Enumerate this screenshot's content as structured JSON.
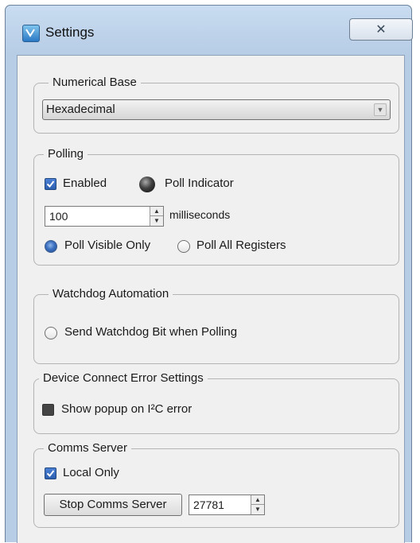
{
  "window": {
    "title": "Settings",
    "close_glyph": "✕",
    "icons": {
      "app": "app-logo-icon",
      "close": "close-icon"
    }
  },
  "numerical_base": {
    "legend": "Numerical Base",
    "selected": "Hexadecimal"
  },
  "polling": {
    "legend": "Polling",
    "enabled_label": "Enabled",
    "enabled_checked": true,
    "indicator_label": "Poll Indicator",
    "interval_value": "100",
    "interval_unit": "milliseconds",
    "poll_visible_label": "Poll Visible Only",
    "poll_all_label": "Poll All Registers",
    "selected_mode": "Poll Visible Only"
  },
  "watchdog": {
    "legend": "Watchdog Automation",
    "send_bit_label": "Send Watchdog Bit when Polling",
    "send_bit_selected": false
  },
  "device_error": {
    "legend": "Device Connect Error Settings",
    "popup_label": "Show popup on I²C error"
  },
  "comms": {
    "legend": "Comms Server",
    "local_only_label": "Local Only",
    "local_only_checked": true,
    "stop_button_label": "Stop Comms Server",
    "port_value": "27781"
  },
  "colors": {
    "title_bar": "#c9dcf0",
    "client_bg": "#f0f0f0",
    "check_blue": "#2d5fb0"
  }
}
